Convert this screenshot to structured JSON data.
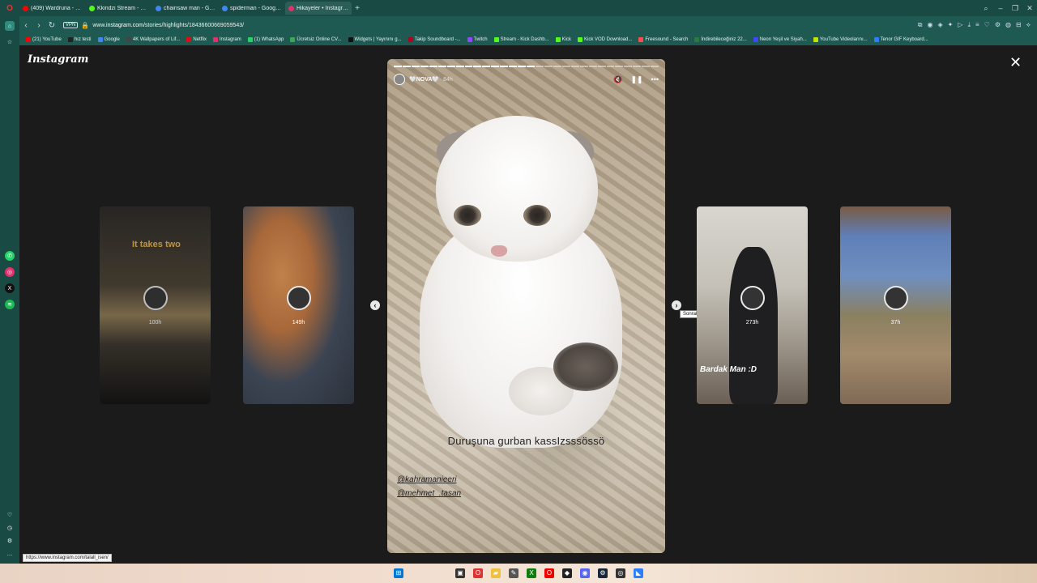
{
  "browser": {
    "tabs": [
      {
        "label": "(409) Wardruna - Eina",
        "color": "#ff0000"
      },
      {
        "label": "Kkindzi Stream - Watch Li",
        "color": "#53fc18"
      },
      {
        "label": "chainsaw man - Google'd",
        "color": "#4285f4"
      },
      {
        "label": "spiderman - Google'da A",
        "color": "#4285f4"
      },
      {
        "label": "Hikayeler • Instagram",
        "color": "#e1306c"
      }
    ],
    "vpn_label": "VPN",
    "url_prefix": "www.",
    "url_domain": "instagram.com",
    "url_path": "/stories/highlights/18436600669059543/",
    "bookmarks": [
      {
        "label": "(21) YouTube",
        "color": "#ff0000"
      },
      {
        "label": "hız testi",
        "color": "#222222"
      },
      {
        "label": "Google",
        "color": "#4285f4"
      },
      {
        "label": "4K Wallpapers of Lif...",
        "color": "#444444"
      },
      {
        "label": "Netflix",
        "color": "#e50914"
      },
      {
        "label": "Instagram",
        "color": "#e1306c"
      },
      {
        "label": "(1) WhatsApp",
        "color": "#25d366"
      },
      {
        "label": "Ücretsiz Online CV...",
        "color": "#3aa757"
      },
      {
        "label": "Widgets | Yayınını g...",
        "color": "#111111"
      },
      {
        "label": "Takip Soundboard -...",
        "color": "#b00020"
      },
      {
        "label": "Twitch",
        "color": "#9146ff"
      },
      {
        "label": "Stream - Kick Dashb...",
        "color": "#53fc18"
      },
      {
        "label": "Kick",
        "color": "#53fc18"
      },
      {
        "label": "Kick VOD Download...",
        "color": "#53fc18"
      },
      {
        "label": "Freesound - Search",
        "color": "#ff4b4b"
      },
      {
        "label": "İndirebileceğiniz 22...",
        "color": "#2b7a3d"
      },
      {
        "label": "Neon Yeşil ve Siyah...",
        "color": "#4444ff"
      },
      {
        "label": "YouTube Videolarını...",
        "color": "#c8e000"
      },
      {
        "label": "Tenor GIF Keyboard...",
        "color": "#2a7fff"
      }
    ],
    "status_url": "https://www.instagram.com/talall_isen/"
  },
  "instagram": {
    "logo": "Instagram",
    "story": {
      "username": "🤍NOVA🤍",
      "time": "84h",
      "caption": "Duruşuna gurban kassIzsssössö",
      "mentions": [
        "@kahramanieeri",
        "@mehmet_.tasan"
      ],
      "progress_segments": 30,
      "progress_done": 16
    },
    "side_cards": [
      {
        "time": "100h",
        "overlay": "It takes two"
      },
      {
        "time": "149h"
      },
      {
        "time": "273h",
        "tagline": "Bardak Man :D"
      },
      {
        "time": "37h"
      }
    ],
    "next_tooltip": "Sonraki"
  }
}
